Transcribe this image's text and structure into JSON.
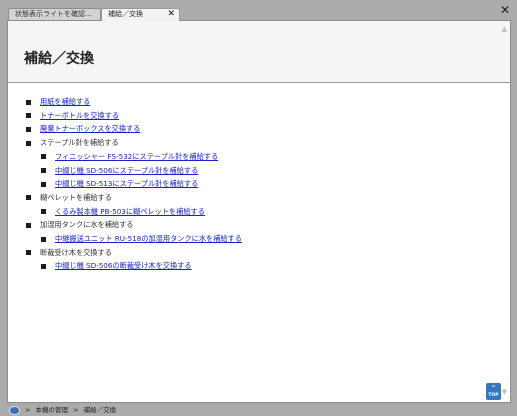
{
  "tabs": [
    {
      "label": "状態表示ライトを確認…"
    },
    {
      "label": "補給／交換",
      "close_glyph": "✕"
    }
  ],
  "window": {
    "close_glyph": "✕"
  },
  "page": {
    "title": "補給／交換"
  },
  "items": [
    {
      "text": "用紙を補給する",
      "link": true,
      "level": 1
    },
    {
      "text": "トナーボトルを交換する",
      "link": true,
      "level": 1
    },
    {
      "text": "廃棄トナーボックスを交換する",
      "link": true,
      "level": 1
    },
    {
      "text": "ステープル針を補給する",
      "link": false,
      "level": 1
    },
    {
      "text": "フィニッシャー FS-532にステープル針を補給する",
      "link": true,
      "level": 2
    },
    {
      "text": "中綴じ機 SD-506にステープル針を補給する",
      "link": true,
      "level": 2
    },
    {
      "text": "中綴じ機 SD-513にステープル針を補給する",
      "link": true,
      "level": 2
    },
    {
      "text": "糊ペレットを補給する",
      "link": false,
      "level": 1
    },
    {
      "text": "くるみ製本機 PB-503に糊ペレットを補給する",
      "link": true,
      "level": 2
    },
    {
      "text": "加湿用タンクに水を補給する",
      "link": false,
      "level": 1
    },
    {
      "text": "中継搬送ユニット RU-518の加湿用タンクに水を補給する",
      "link": true,
      "level": 2
    },
    {
      "text": "断裁受け木を交換する",
      "link": false,
      "level": 1
    },
    {
      "text": "中綴じ機 SD-506の断裁受け木を交換する",
      "link": true,
      "level": 2
    }
  ],
  "top_button": {
    "label": "TOP",
    "arrow": "⌃"
  },
  "breadcrumb": {
    "separator": ">",
    "items": [
      "本機の管理",
      "補給／交換"
    ]
  },
  "colors": {
    "link": "#1a22cc",
    "top_button": "#3277c4",
    "chrome": "#ababab"
  }
}
